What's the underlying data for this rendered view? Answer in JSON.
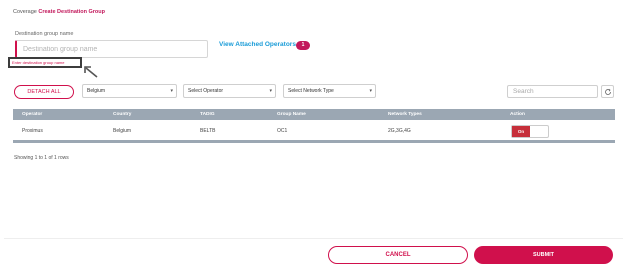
{
  "breadcrumb": {
    "parent": "Coverage",
    "current": "Create Destination Group"
  },
  "form": {
    "label": "Destination group name",
    "placeholder": "Destination group name",
    "value": "",
    "error": "Enter destination group name"
  },
  "attached": {
    "link_label": "View Attached Operators",
    "count": "1"
  },
  "toolbar": {
    "detach_label": "DETACH ALL",
    "country_select": "Belgium",
    "operator_select": "Select Operator",
    "network_select": "Select Network Type",
    "search_placeholder": "Search"
  },
  "table": {
    "headers": [
      "Operator",
      "Country",
      "TADIG",
      "Group Name",
      "Network Types",
      "Action"
    ],
    "rows": [
      {
        "operator": "Proximus",
        "country": "Belgium",
        "tadig": "BELTB",
        "group": "OC1",
        "network_types": "2G,3G,4G",
        "action_toggle": "On"
      }
    ]
  },
  "pagination": {
    "summary": "Showing 1 to 1 of 1 rows"
  },
  "footer": {
    "cancel_label": "CANCEL",
    "submit_label": "SUBMIT"
  },
  "colors": {
    "accent": "#d0104c",
    "link": "#1a9cd8",
    "table_header": "#9ba7b3",
    "toggle_on": "#c62f3a"
  },
  "icons": {
    "refresh": "refresh-icon",
    "caret": "chevron-down-icon",
    "annotation": "arrow-icon"
  }
}
